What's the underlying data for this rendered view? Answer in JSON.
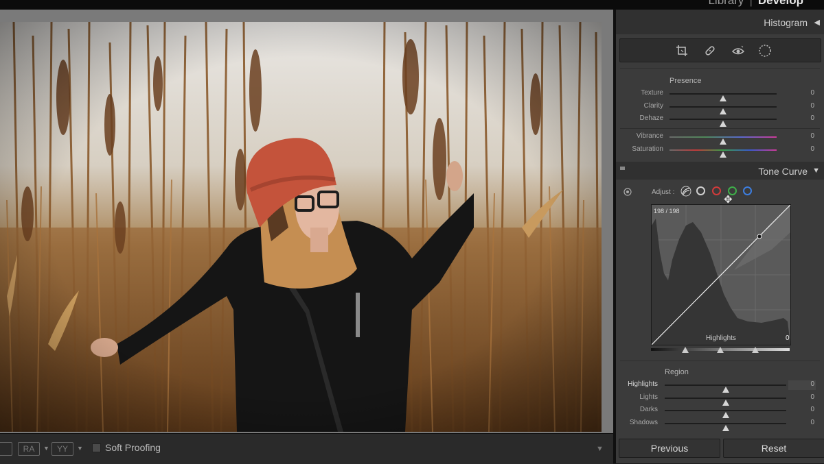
{
  "top": {
    "modules": [
      "Library",
      "Develop"
    ],
    "active_module": "Develop"
  },
  "toolbar": {
    "view_mode_1": "RA",
    "view_mode_2": "YY",
    "soft_proofing_label": "Soft Proofing"
  },
  "panel": {
    "histogram_title": "Histogram",
    "presence": {
      "title": "Presence",
      "sliders": [
        {
          "label": "Texture",
          "value": "0",
          "level": 0.5
        },
        {
          "label": "Clarity",
          "value": "0",
          "level": 0.5
        },
        {
          "label": "Dehaze",
          "value": "0",
          "level": 0.5
        },
        {
          "label": "Vibrance",
          "value": "0",
          "level": 0.5
        },
        {
          "label": "Saturation",
          "value": "0",
          "level": 0.5
        }
      ]
    },
    "tone_curve": {
      "title": "Tone Curve",
      "adjust_label": "Adjust :",
      "readout": "198 / 198",
      "region_readout_label": "Highlights",
      "region_readout_value": "0",
      "region": {
        "title": "Region",
        "sliders": [
          {
            "label": "Highlights",
            "value": "0",
            "level": 0.5
          },
          {
            "label": "Lights",
            "value": "0",
            "level": 0.5
          },
          {
            "label": "Darks",
            "value": "0",
            "level": 0.5
          },
          {
            "label": "Shadows",
            "value": "0",
            "level": 0.5
          }
        ]
      }
    },
    "buttons": {
      "previous": "Previous",
      "reset": "Reset"
    }
  },
  "colors": {
    "panel_bg": "#3b3b3b",
    "header_bg": "#303030",
    "viewer_bg": "#7a7a7a",
    "channel_red": "#d23b3b",
    "channel_green": "#3fb04a",
    "channel_blue": "#3d7ee0"
  }
}
